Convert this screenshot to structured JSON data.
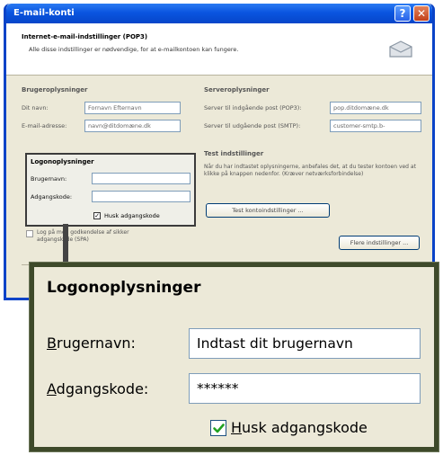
{
  "window": {
    "title": "E-mail-konti",
    "help_label": "?",
    "close_label": "✕"
  },
  "header": {
    "title": "Internet-e-mail-indstillinger (POP3)",
    "subtitle": "Alle disse indstillinger er nødvendige, for at e-mailkontoen kan fungere."
  },
  "user_info": {
    "heading": "Brugeroplysninger",
    "name_label": "Dit navn:",
    "name_value": "Fornavn Efternavn",
    "email_label": "E-mail-adresse:",
    "email_value": "navn@ditdomæne.dk"
  },
  "server_info": {
    "heading": "Serveroplysninger",
    "incoming_label": "Server til indgående post (POP3):",
    "incoming_value": "pop.ditdomæne.dk",
    "outgoing_label": "Server til udgående post (SMTP):",
    "outgoing_value": "customer-smtp.b-"
  },
  "test_settings": {
    "heading": "Test indstillinger",
    "description": "Når du har indtastet oplysningerne, anbefales det, at du tester kontoen ved at klikke på knappen nedenfor. (Kræver netværksforbindelse)",
    "test_button": "Test kontoindstillinger ...",
    "more_button": "Flere indstillinger ..."
  },
  "spa": {
    "label": "Log på med godkendelse af sikker adgangskode (SPA)"
  },
  "logon_mini": {
    "heading": "Logonoplysninger",
    "username_label": "Brugernavn:",
    "password_label": "Adgangskode:",
    "remember_label": "Husk adgangskode",
    "remember_mark": "✓"
  },
  "logon_zoom": {
    "heading": "Logonoplysninger",
    "username_label_ul": "B",
    "username_label_rest": "rugernavn:",
    "username_value": "Indtast dit brugernavn",
    "password_label_ul": "A",
    "password_label_rest": "dgangskode:",
    "password_value": "******",
    "remember_ul": "H",
    "remember_rest": "usk adgangskode",
    "remember_checked": true,
    "check_color": "#21a121"
  }
}
